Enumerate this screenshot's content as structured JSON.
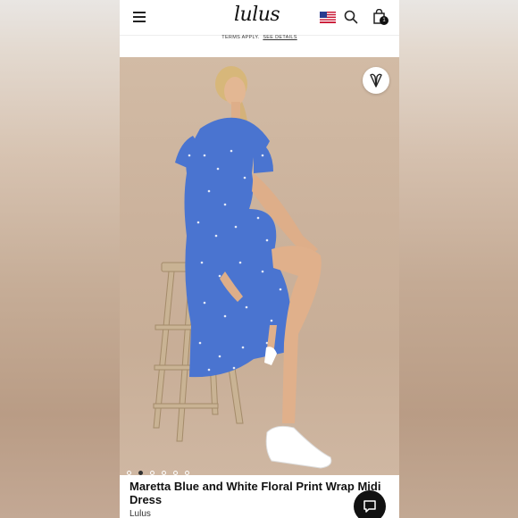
{
  "header": {
    "logo_text": "lulus",
    "flag_icon": "us-flag-icon",
    "search_icon": "search-icon",
    "bag_icon": "shopping-bag-icon",
    "bag_count": "1"
  },
  "promo": {
    "text": "TERMS APPLY.",
    "link_label": "SEE DETAILS"
  },
  "product": {
    "title": "Maretta Blue and White Floral Print Wrap Midi Dress",
    "brand": "Lulus",
    "dress_color": "#4a74d0",
    "wishlist_icon": "heart-icon",
    "carousel": {
      "count": 6,
      "active_index": 1
    }
  },
  "chat": {
    "icon": "chat-bubble-icon"
  }
}
